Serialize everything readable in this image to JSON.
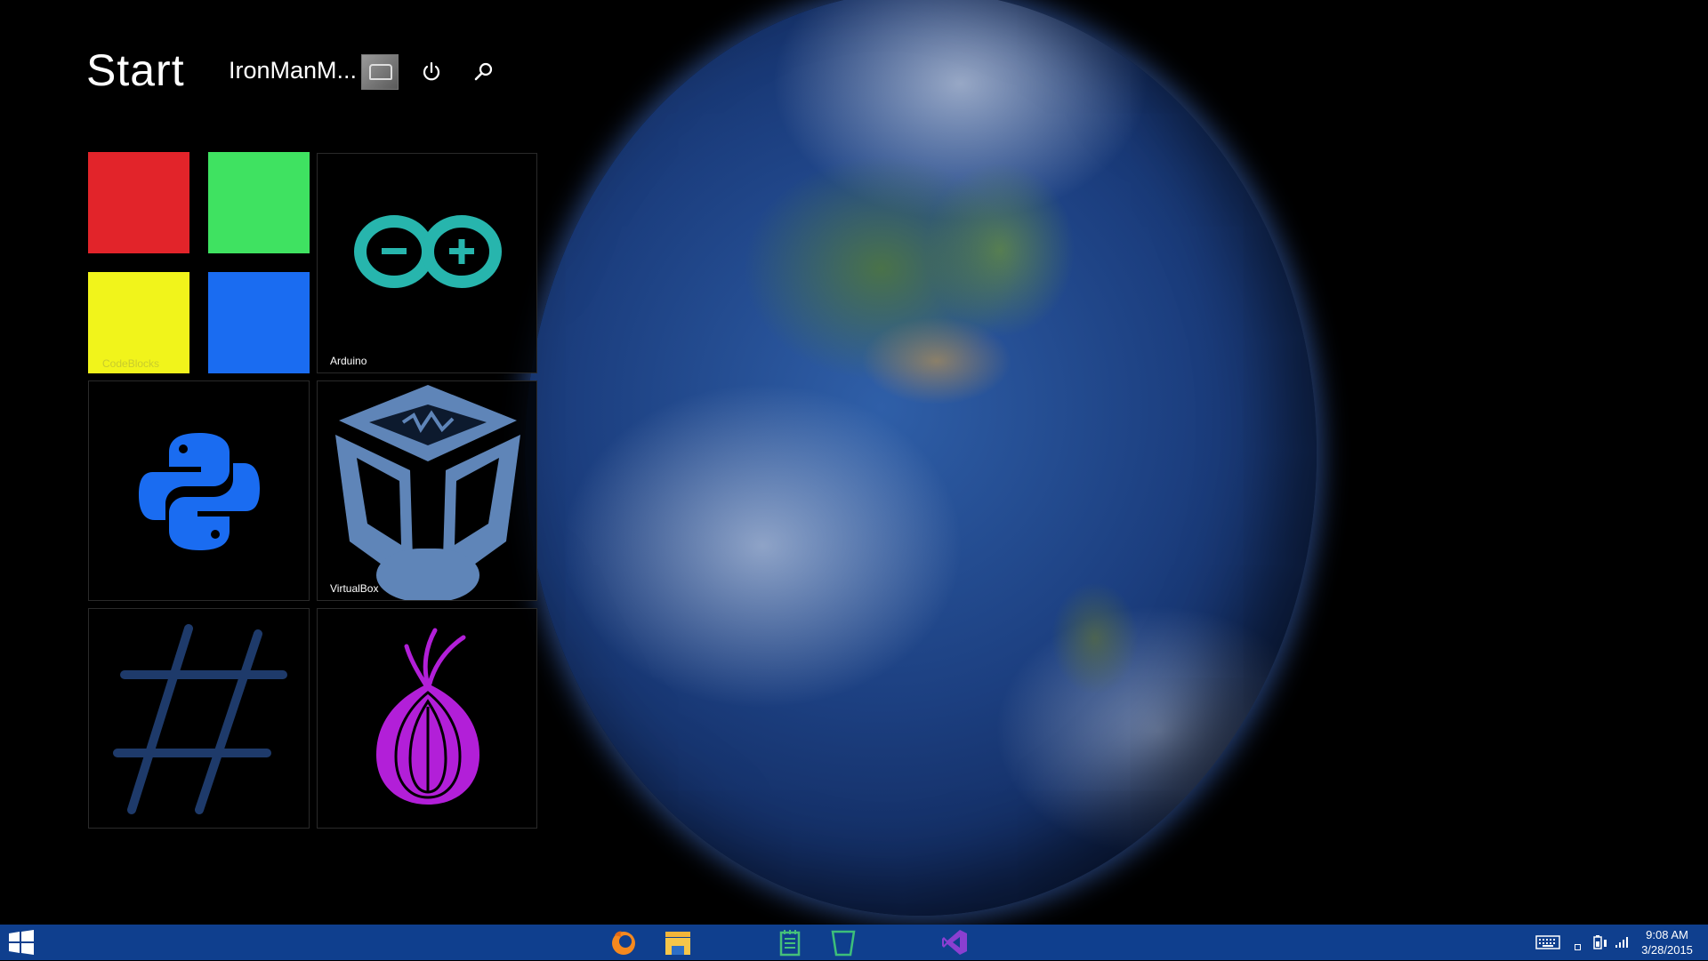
{
  "start_screen": {
    "title": "Start",
    "user": {
      "name": "IronManM..."
    },
    "tiles": [
      {
        "id": "codeblocks",
        "label": "CodeBlocks",
        "icon": "codeblocks-icon",
        "colors": [
          "#e2242a",
          "#3fe261",
          "#f1f41b",
          "#1a6cf1"
        ]
      },
      {
        "id": "arduino",
        "label": "Arduino",
        "icon": "arduino-icon",
        "color": "#27b5ad"
      },
      {
        "id": "python",
        "label": "",
        "icon": "python-icon",
        "color": "#1a6cf1"
      },
      {
        "id": "virtualbox",
        "label": "VirtualBox",
        "icon": "virtualbox-icon",
        "color": "#5f85b8"
      },
      {
        "id": "hash",
        "label": "",
        "icon": "hash-icon",
        "color": "#1e3a6a"
      },
      {
        "id": "tor",
        "label": "",
        "icon": "tor-onion-icon",
        "color": "#b21fd8"
      }
    ]
  },
  "taskbar": {
    "start_icon": "windows-logo-icon",
    "pinned": [
      "firefox-icon",
      "file-explorer-icon",
      "notepad-icon",
      "recycle-bin-icon",
      "visual-studio-icon"
    ],
    "tray": [
      "keyboard-icon",
      "show-hidden-icons-icon",
      "battery-icon",
      "signal-icon"
    ],
    "clock": {
      "time": "9:08 AM",
      "date": "3/28/2015"
    },
    "color": "#0f3f8e"
  }
}
